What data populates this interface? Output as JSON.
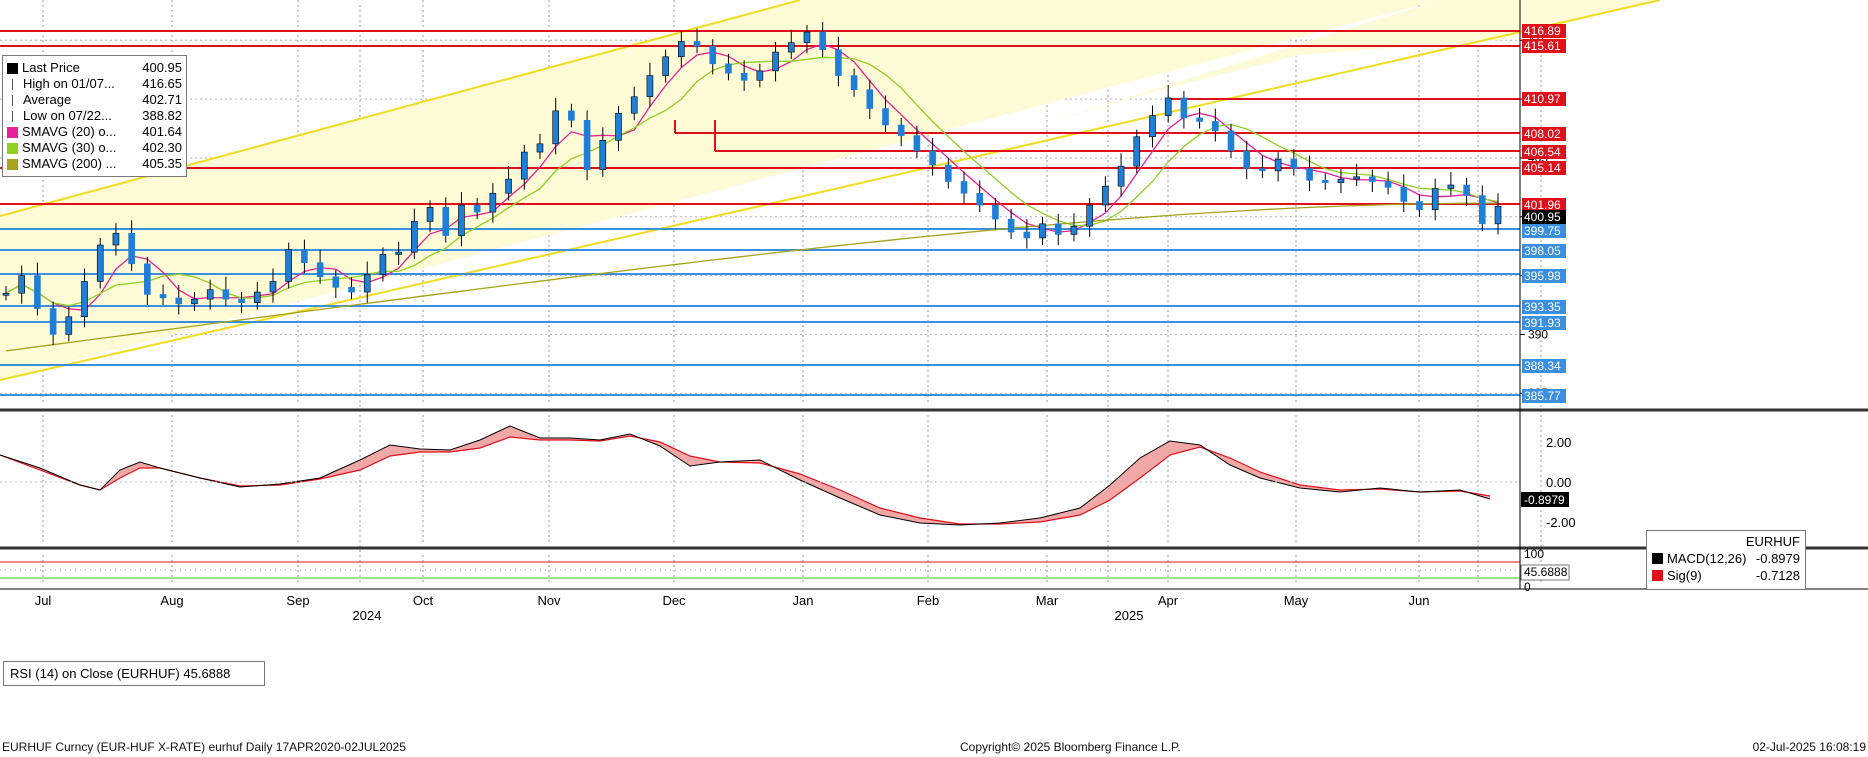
{
  "footer": {
    "left": "EURHUF Curncy (EUR-HUF X-RATE) eurhuf  Daily 17APR2020-02JUL2025",
    "center": "Copyright© 2025 Bloomberg Finance L.P.",
    "right": "02-Jul-2025 16:08:19"
  },
  "legend": {
    "items": [
      {
        "name": "Last Price",
        "value": "400.95",
        "color": "#000000",
        "marker": "square"
      },
      {
        "name": "High on 01/07...",
        "value": "416.65",
        "color": "#555555",
        "marker": "high"
      },
      {
        "name": "Average",
        "value": "402.71",
        "color": "#555555",
        "marker": "avg"
      },
      {
        "name": "Low on 07/22...",
        "value": "388.82",
        "color": "#555555",
        "marker": "low"
      },
      {
        "name": "SMAVG (20)  o...",
        "value": "401.64",
        "color": "#e8219a",
        "marker": "square"
      },
      {
        "name": "SMAVG (30)  o...",
        "value": "402.30",
        "color": "#8ed11f",
        "marker": "square"
      },
      {
        "name": "SMAVG (200)  ...",
        "value": "405.35",
        "color": "#a6a31a",
        "marker": "square"
      }
    ]
  },
  "macd_box": {
    "title": "EURHUF",
    "items": [
      {
        "name": "MACD(12,26)",
        "value": "-0.8979",
        "color": "#000000"
      },
      {
        "name": "Sig(9)",
        "value": "-0.7128",
        "color": "#e0101a"
      }
    ]
  },
  "rsi_box": {
    "label": "RSI (14)  on Close (EURHUF) 45.6888"
  },
  "chart_data": [
    {
      "type": "candlestick",
      "title": "EURHUF",
      "x_months": [
        "Jul",
        "Aug",
        "Sep",
        "Oct",
        "Nov",
        "Dec",
        "Jan",
        "Feb",
        "Mar",
        "Apr",
        "May",
        "Jun"
      ],
      "x_years": [
        "2024",
        "2025"
      ],
      "ylim": [
        384,
        418
      ],
      "y_ticks": [
        385,
        390,
        395,
        400,
        405,
        410,
        415
      ],
      "up_color": "#1f7fd6",
      "down_color": "#1f7fd6",
      "neutral_color": "#000000",
      "series": [
        {
          "name": "Last Price",
          "values": [
            393.5,
            395.0,
            392.2,
            390.0,
            391.5,
            394.5,
            397.6,
            398.6,
            396.0,
            393.4,
            393.1,
            392.6,
            393.0,
            393.8,
            393.0,
            392.7,
            393.6,
            394.5,
            397.2,
            396.1,
            394.9,
            394.0,
            393.6,
            395.1,
            396.8,
            397.0,
            399.6,
            400.8,
            398.4,
            401.0,
            400.4,
            402.0,
            403.2,
            405.5,
            406.2,
            409.0,
            408.2,
            404.0,
            406.5,
            408.8,
            410.2,
            412.0,
            413.6,
            414.9,
            414.5,
            413.0,
            412.2,
            411.6,
            412.4,
            414.0,
            414.8,
            415.7,
            414.2,
            412.0,
            410.8,
            409.2,
            407.8,
            406.9,
            405.6,
            404.4,
            403.0,
            402.0,
            401.0,
            399.8,
            398.7,
            398.2,
            399.4,
            398.5,
            399.2,
            401.0,
            402.6,
            404.3,
            406.8,
            408.6,
            410.1,
            408.4,
            408.1,
            407.3,
            405.6,
            404.1,
            403.9,
            404.9,
            404.1,
            403.1,
            402.9,
            403.2,
            403.4,
            403.0,
            402.5,
            401.3,
            400.6,
            402.4,
            402.7,
            401.8,
            399.4,
            400.9
          ]
        },
        {
          "name": "Average",
          "values": [
            402.71
          ]
        },
        {
          "name": "SMAVG (20)",
          "values": [
            401.64
          ]
        },
        {
          "name": "SMAVG (30)",
          "values": [
            402.3
          ]
        },
        {
          "name": "SMAVG (200)",
          "values": [
            405.35
          ]
        }
      ],
      "price_labels": [
        {
          "value": "416.89",
          "color": "#e0101a"
        },
        {
          "value": "415.61",
          "color": "#e0101a"
        },
        {
          "value": "410.97",
          "color": "#e0101a"
        },
        {
          "value": "408.02",
          "color": "#e0101a"
        },
        {
          "value": "406.54",
          "color": "#e0101a"
        },
        {
          "value": "405.14",
          "color": "#e0101a"
        },
        {
          "value": "401.96",
          "color": "#e0101a"
        },
        {
          "value": "400.95",
          "color": "#000000"
        },
        {
          "value": "399.75",
          "color": "#3a8fe0"
        },
        {
          "value": "398.05",
          "color": "#3a8fe0"
        },
        {
          "value": "395.98",
          "color": "#3a8fe0"
        },
        {
          "value": "393.35",
          "color": "#3a8fe0"
        },
        {
          "value": "391.93",
          "color": "#3a8fe0"
        },
        {
          "value": "388.34",
          "color": "#3a8fe0"
        },
        {
          "value": "385.77",
          "color": "#3a8fe0"
        }
      ],
      "high": 416.65,
      "low": 388.82
    },
    {
      "type": "line",
      "title": "EURHUF",
      "ylim": [
        -3,
        3
      ],
      "y_ticks": [
        "2.00",
        "0.00",
        "-2.00"
      ],
      "series": [
        {
          "name": "MACD(12,26)",
          "last": "-0.8979",
          "color": "#000000"
        },
        {
          "name": "Sig(9)",
          "last": "-0.7128",
          "color": "#e0101a"
        }
      ]
    },
    {
      "type": "line",
      "ylim": [
        0,
        100
      ],
      "y_ticks": [
        "100",
        "0"
      ],
      "series": [
        {
          "name": "RSI (14)  on Close (EURHUF)",
          "last": "45.6888"
        }
      ]
    }
  ]
}
